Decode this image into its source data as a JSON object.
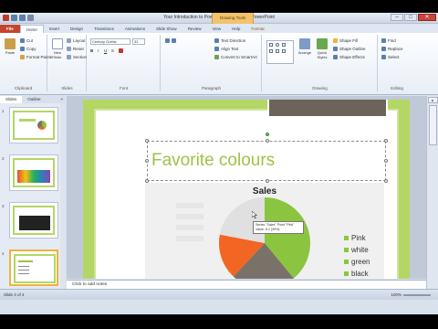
{
  "window": {
    "title": "Your Introduction to PowerPoint - Microsoft PowerPoint",
    "contextual_tab": "Drawing Tools",
    "minimize": "–",
    "maximize": "□",
    "close": "✕"
  },
  "tabs": [
    "File",
    "Home",
    "Insert",
    "Design",
    "Transitions",
    "Animations",
    "Slide Show",
    "Review",
    "View",
    "Help",
    "Format"
  ],
  "ribbon": {
    "clipboard": {
      "paste": "Paste",
      "cut": "Cut",
      "copy": "Copy",
      "format_painter": "Format Painter",
      "label": "Clipboard"
    },
    "slides": {
      "new_slide": "New Slide",
      "layout": "Layout",
      "reset": "Reset",
      "section": "Section",
      "label": "Slides"
    },
    "font": {
      "name": "Century Gothic",
      "size": "32",
      "label": "Font"
    },
    "paragraph": {
      "text_direction": "Text Direction",
      "align_text": "Align Text",
      "convert_smartart": "Convert to SmartArt",
      "label": "Paragraph"
    },
    "drawing": {
      "arrange": "Arrange",
      "quick_styles": "Quick Styles",
      "shape_fill": "Shape Fill",
      "shape_outline": "Shape Outline",
      "shape_effects": "Shape Effects",
      "label": "Drawing"
    },
    "editing": {
      "find": "Find",
      "replace": "Replace",
      "select": "Select",
      "label": "Editing"
    }
  },
  "left_pane": {
    "tab_slides": "Slides",
    "tab_outline": "Outline",
    "close": "×",
    "slide_numbers": [
      "1",
      "2",
      "3",
      "4"
    ]
  },
  "slide": {
    "title": "Favorite colours",
    "chart_title": "Sales",
    "tooltip": "Series \"Sales\" Point \"Pink\"\nValue: 8.2 (39%)"
  },
  "chart_data": {
    "type": "pie",
    "title": "Sales",
    "categories": [
      "Pink",
      "white",
      "green",
      "black"
    ],
    "values": [
      39,
      23,
      16,
      22
    ],
    "colors": [
      "#8bc53f",
      "#7a7168",
      "#f26522",
      "#e0e0e0"
    ]
  },
  "notes": {
    "placeholder": "Click to add notes"
  },
  "status": {
    "slide_info": "Slide 4 of 4",
    "zoom": "100%"
  }
}
